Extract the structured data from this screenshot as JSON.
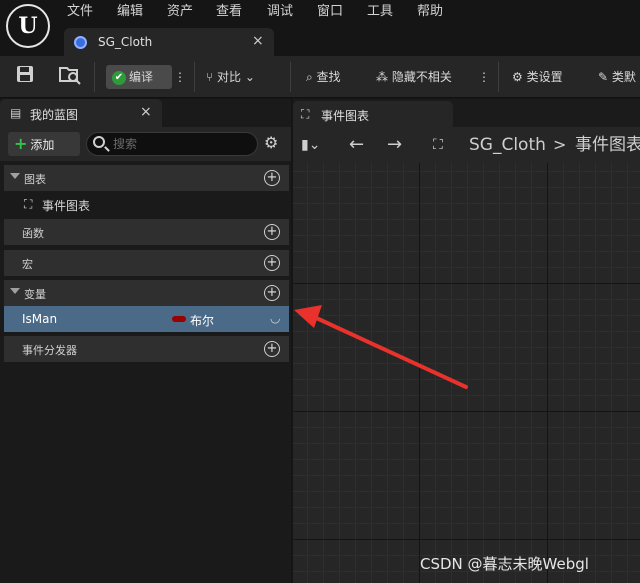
{
  "app": {
    "logo_letter": "U",
    "menu": [
      "文件",
      "编辑",
      "资产",
      "查看",
      "调试",
      "窗口",
      "工具",
      "帮助"
    ],
    "document_tab": {
      "label": "SG_Cloth",
      "close": "×"
    }
  },
  "toolbar": {
    "compile_label": "编译",
    "diff_label": "对比",
    "find_label": "查找",
    "hide_label": "隐藏不相关",
    "class_settings_label": "类设置",
    "class_defaults_label": "类默"
  },
  "my_blueprint": {
    "tab_label": "我的蓝图",
    "close": "×",
    "add_label": "添加",
    "search_placeholder": "搜索",
    "sections": {
      "graphs": "图表",
      "functions": "函数",
      "macros": "宏",
      "variables": "变量",
      "event_dispatchers": "事件分发器"
    },
    "graph_items": [
      {
        "label": "事件图表"
      }
    ],
    "variables": [
      {
        "name": "IsMan",
        "type": "布尔",
        "type_color": "#9a0000"
      }
    ]
  },
  "graph_editor": {
    "tab_label": "事件图表",
    "breadcrumb_root": "SG_Cloth",
    "breadcrumb_sep": ">",
    "breadcrumb_current": "事件图表"
  },
  "annotation": {
    "color": "#e8322b"
  },
  "watermark": "CSDN @暮志未晚Webgl"
}
